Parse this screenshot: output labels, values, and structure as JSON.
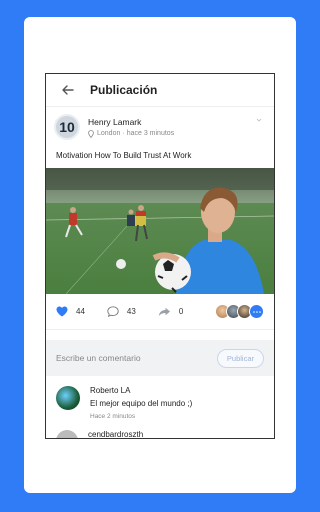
{
  "header": {
    "title": "Publicación"
  },
  "post": {
    "author": "Henry Lamark",
    "avatar_text": "10",
    "location": "London",
    "time": "hace 3 minutos",
    "meta_separator": "·",
    "caption": "Motivation How To Build Trust At Work",
    "likes": "44",
    "comments": "43",
    "shares": "0"
  },
  "compose": {
    "placeholder": "Escribe un comentario",
    "button": "Publicar"
  },
  "comments": [
    {
      "name": "Roberto LA",
      "text": "El mejor equipo del mundo ;)",
      "time": "Hace 2 minutos"
    },
    {
      "name": "cendbardroszth"
    }
  ],
  "colors": {
    "accent": "#2f7cf6",
    "background": "#2f7cf6"
  }
}
